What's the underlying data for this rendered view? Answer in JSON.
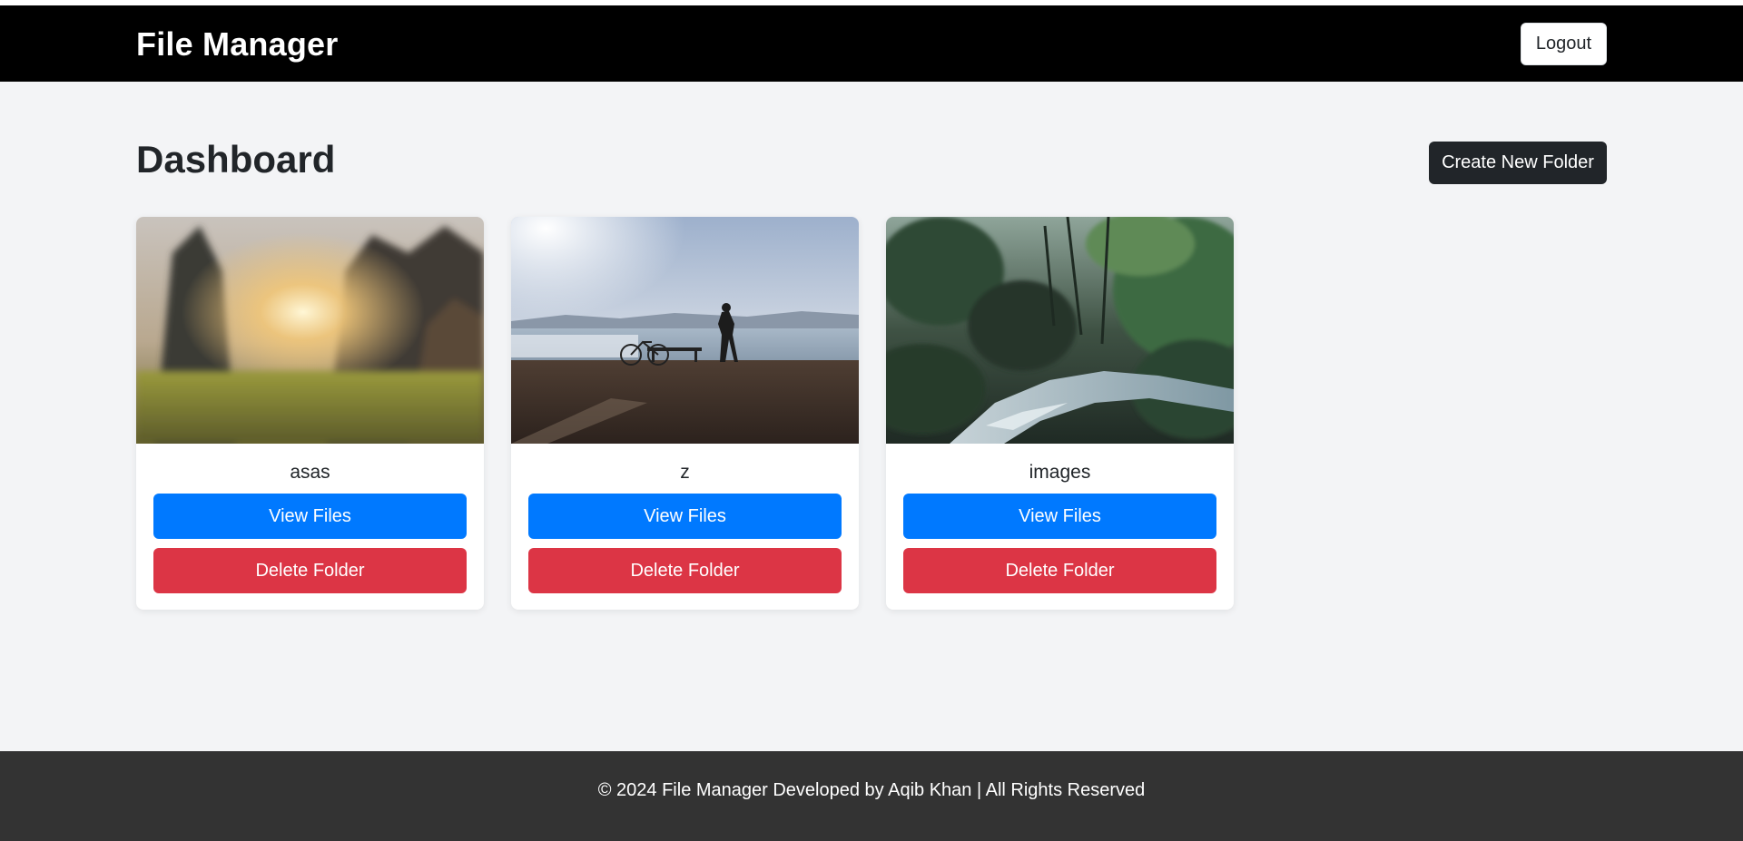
{
  "header": {
    "brand": "File Manager",
    "logout_label": "Logout"
  },
  "main": {
    "title": "Dashboard",
    "create_folder_label": "Create New Folder"
  },
  "folders": [
    {
      "name": "asas",
      "view_label": "View Files",
      "delete_label": "Delete Folder",
      "image": "sunset-meadow-photo"
    },
    {
      "name": "z",
      "view_label": "View Files",
      "delete_label": "Delete Folder",
      "image": "lakeside-bicycle-photo"
    },
    {
      "name": "images",
      "view_label": "View Files",
      "delete_label": "Delete Folder",
      "image": "forest-stream-photo"
    }
  ],
  "footer": {
    "text": "© 2024 File Manager Developed by Aqib Khan | All Rights Reserved"
  },
  "colors": {
    "navbar": "#000000",
    "background": "#f3f4f6",
    "primary": "#0079ff",
    "danger": "#dc3545",
    "dark_button": "#212529",
    "footer": "#333333"
  }
}
